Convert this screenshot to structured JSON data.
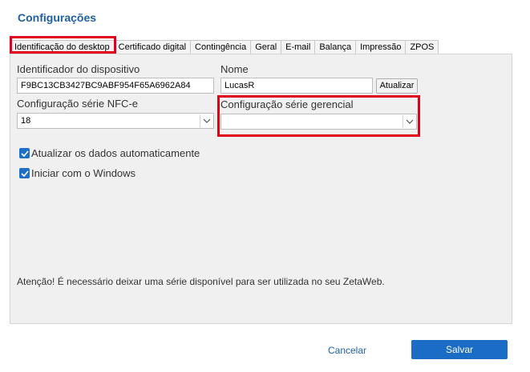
{
  "dialog": {
    "title": "Configurações"
  },
  "tabs": [
    {
      "label": "Identificação do desktop",
      "active": true
    },
    {
      "label": "Certificado digital"
    },
    {
      "label": "Contingência"
    },
    {
      "label": "Geral"
    },
    {
      "label": "E-mail"
    },
    {
      "label": "Balança"
    },
    {
      "label": "Impressão"
    },
    {
      "label": "ZPOS"
    }
  ],
  "form": {
    "device_id_label": "Identificador do dispositivo",
    "device_id_value": "F9BC13CB3427BC9ABF954F65A6962A84",
    "name_label": "Nome",
    "name_value": "LucasR",
    "update_button": "Atualizar",
    "nfce_series_label": "Configuração série NFC-e",
    "nfce_series_value": "18",
    "managerial_series_label": "Configuração série gerencial",
    "managerial_series_value": "",
    "auto_update_label": "Atualizar os dados automaticamente",
    "auto_update_checked": true,
    "start_with_windows_label": "Iniciar com o Windows",
    "start_with_windows_checked": true,
    "notice": "Atenção! É necessário deixar uma série disponível para ser utilizada no seu ZetaWeb."
  },
  "footer": {
    "cancel_label": "Cancelar",
    "save_label": "Salvar"
  },
  "colors": {
    "accent": "#1a6cc4",
    "title": "#1f5fa6",
    "highlight": "#e0001b",
    "panel_bg": "#f0f0f0"
  }
}
